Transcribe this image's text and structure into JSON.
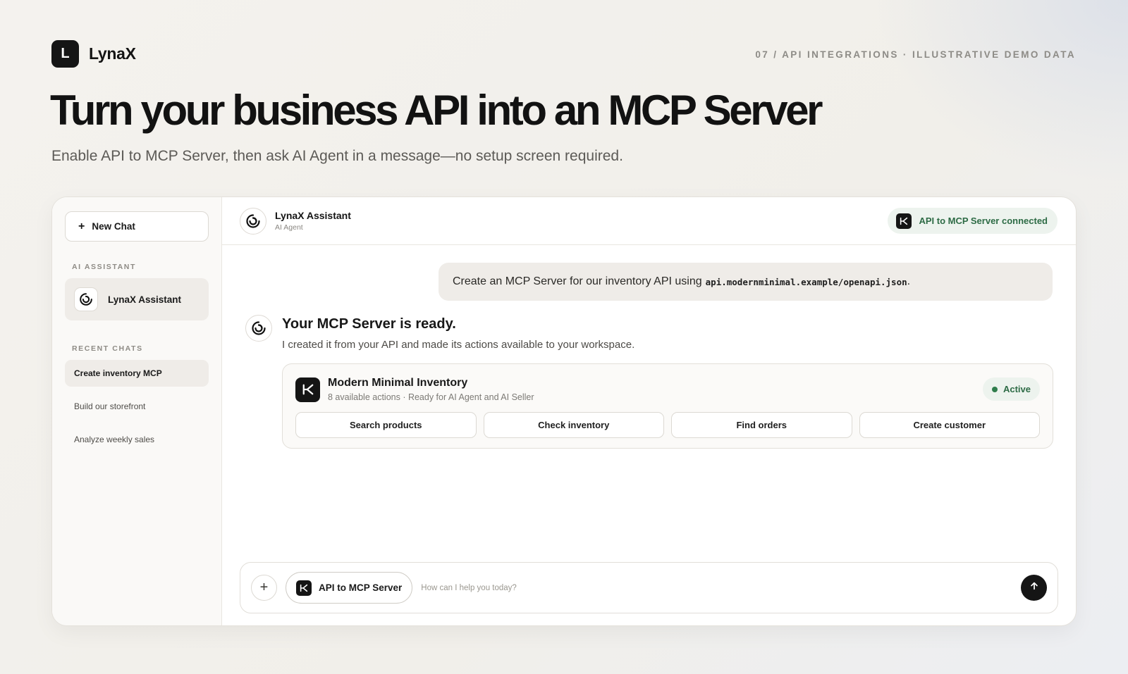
{
  "brand": {
    "logo_letter": "L",
    "name": "LynaX"
  },
  "eyebrow": "07 / API INTEGRATIONS · ILLUSTRATIVE DEMO DATA",
  "headline": "Turn your business API into an MCP Server",
  "subhead": "Enable API to MCP Server, then ask AI Agent in a message—no setup screen required.",
  "sidebar": {
    "new_chat": {
      "icon": "plus-icon",
      "label": "New Chat"
    },
    "assistant_section_label": "AI ASSISTANT",
    "assistant": {
      "icon": "swirl-logo-icon",
      "name": "LynaX Assistant"
    },
    "recent_section_label": "RECENT CHATS",
    "recent_chats": [
      {
        "label": "Create inventory MCP",
        "active": true
      },
      {
        "label": "Build our storefront",
        "active": false
      },
      {
        "label": "Analyze weekly sales",
        "active": false
      }
    ]
  },
  "header": {
    "agent_name": "LynaX Assistant",
    "agent_role": "AI Agent",
    "connection_badge": {
      "icon": "mcp-icon",
      "label": "API to MCP Server connected"
    }
  },
  "messages": {
    "user": {
      "text": "Create an MCP Server for our inventory API using",
      "code": "api.modernminimal.example/openapi.json",
      "trailing": "."
    },
    "assistant": {
      "title": "Your MCP Server is ready.",
      "body": "I created it from your API and made its actions available to your workspace.",
      "server_card": {
        "name": "Modern Minimal Inventory",
        "meta": "8 available actions · Ready for AI Agent and AI Seller",
        "status": "Active",
        "actions": [
          "Search products",
          "Check inventory",
          "Find orders",
          "Create customer"
        ]
      }
    }
  },
  "composer": {
    "tool_chip": "API to MCP Server",
    "placeholder": "How can I help you today?",
    "send_icon": "arrow-up-icon"
  },
  "colors": {
    "accent_dark": "#151515",
    "success_text": "#2d6b45",
    "success_bg": "#edf3ee",
    "background": "#f2f0ec"
  }
}
